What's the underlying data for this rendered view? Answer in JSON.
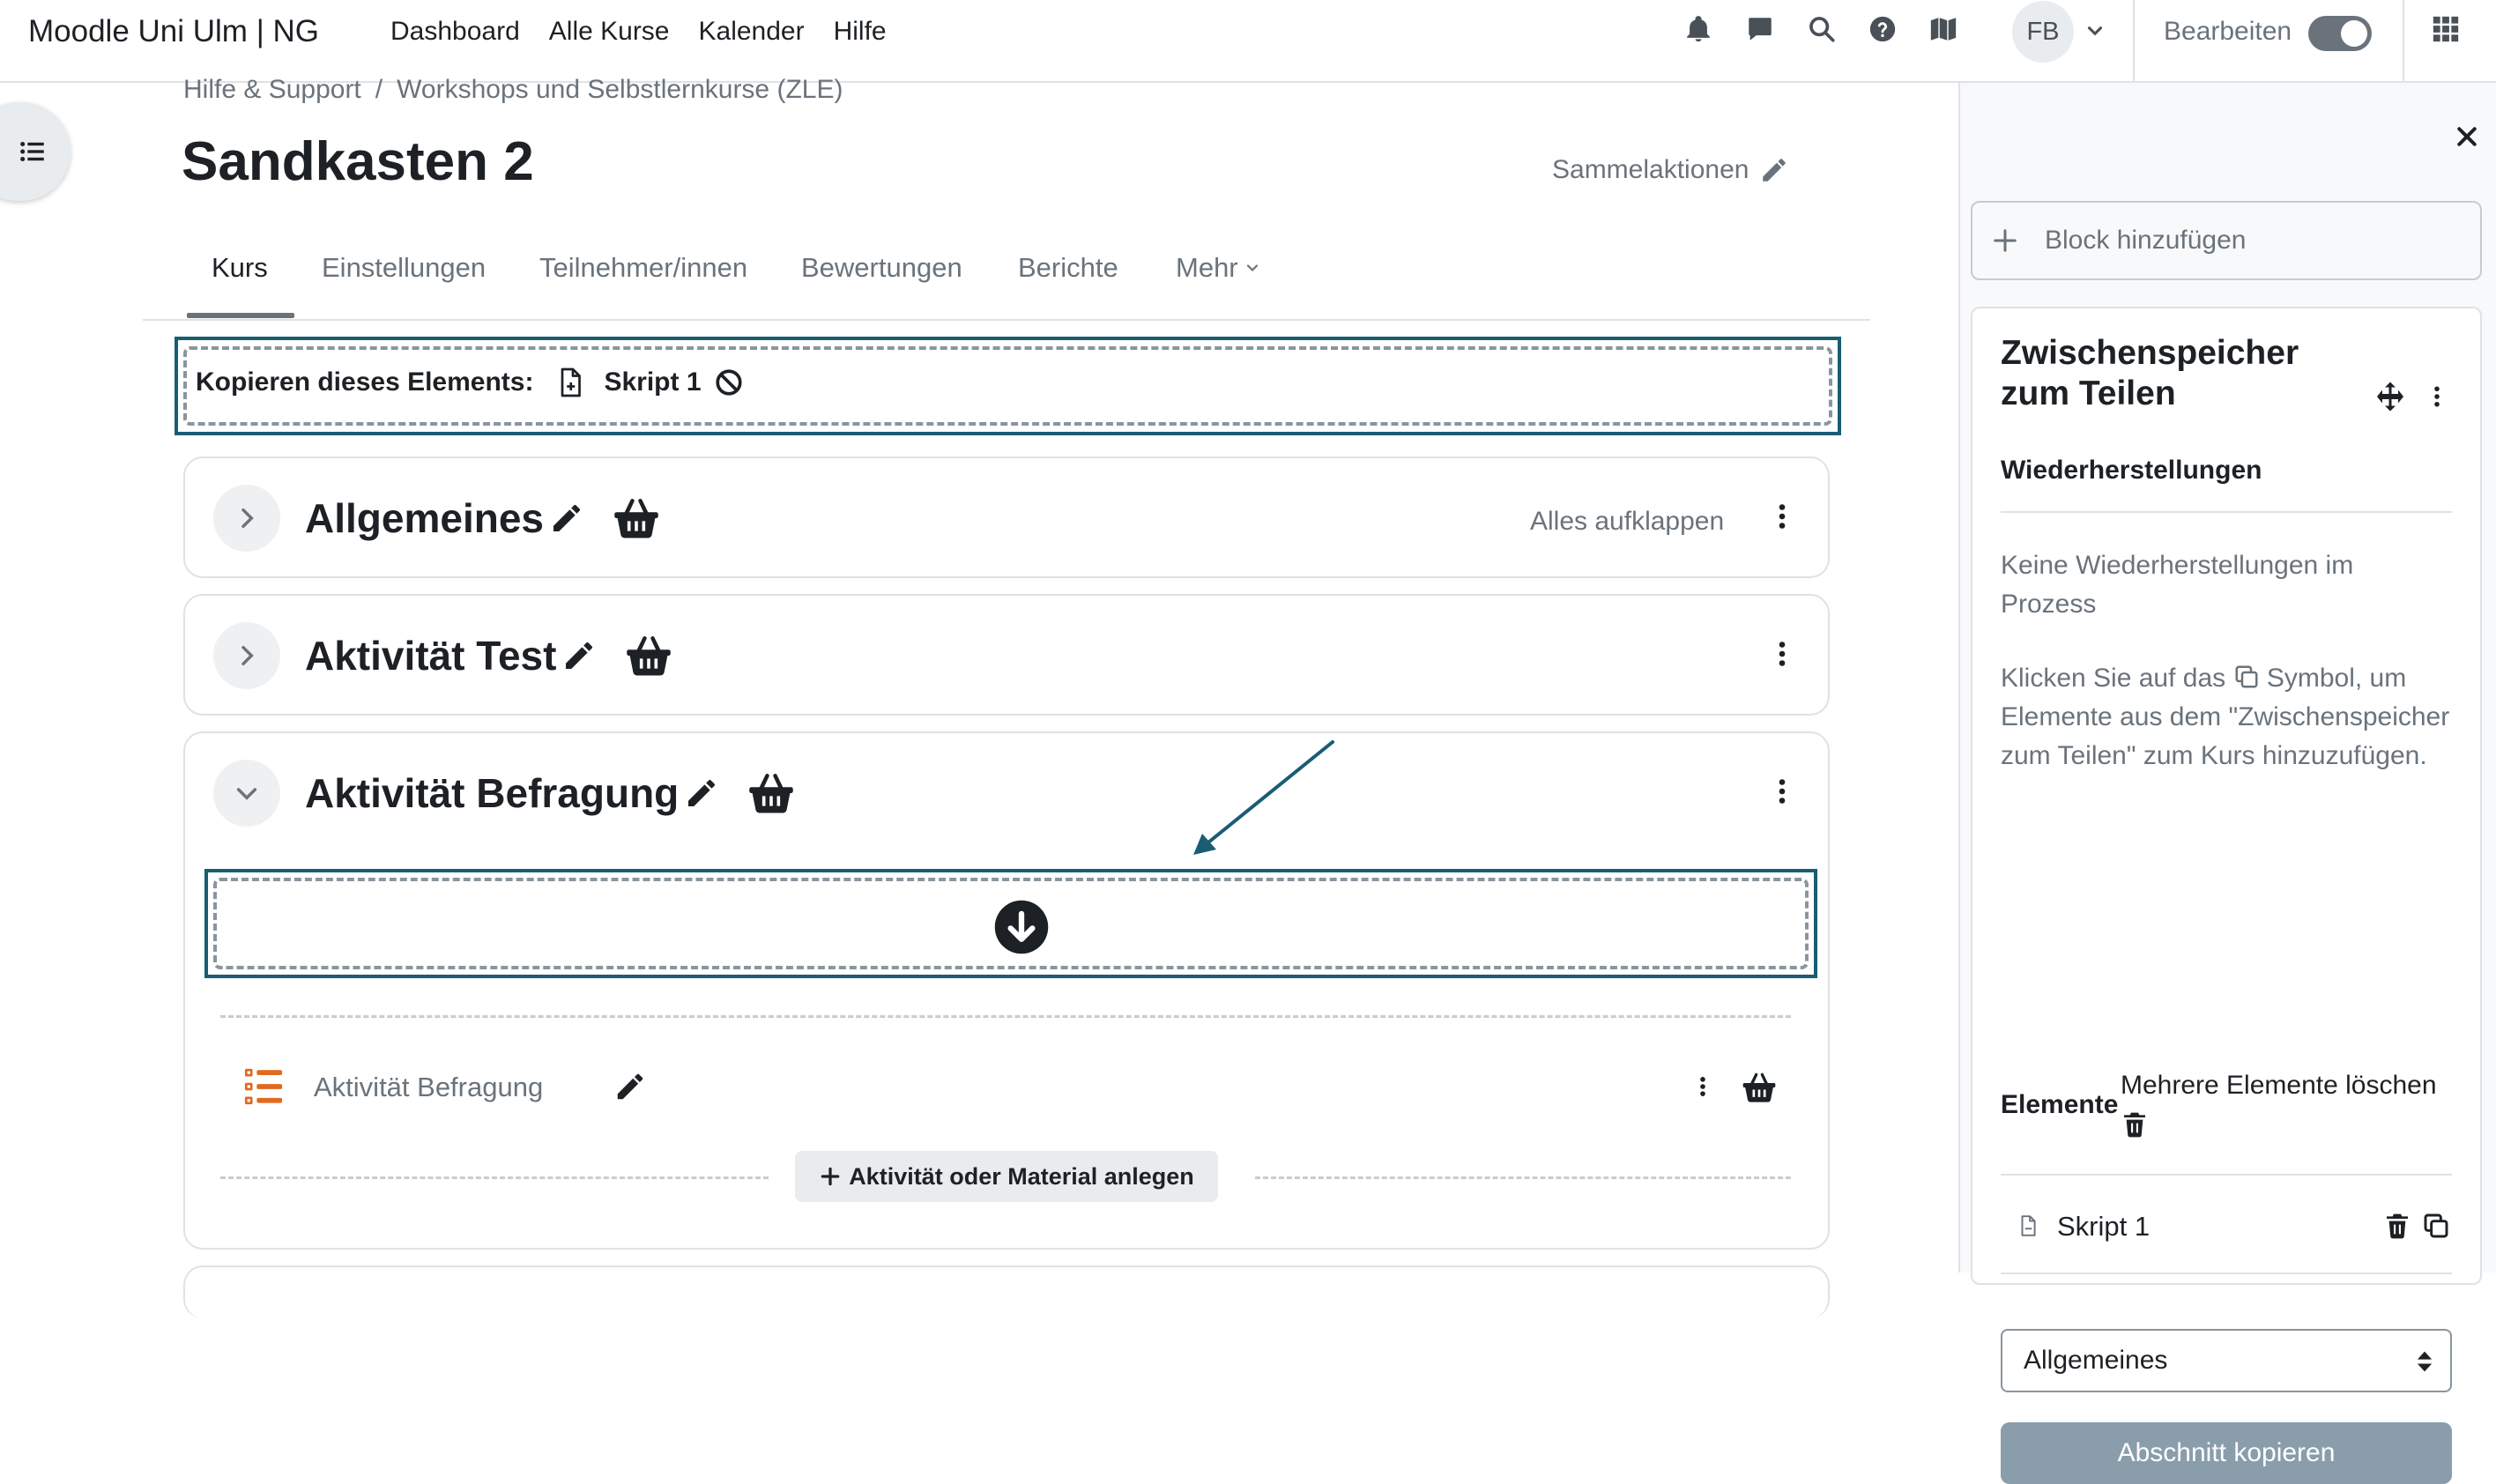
{
  "navbar": {
    "brand": "Moodle Uni Ulm | NG",
    "items": [
      {
        "label": "Dashboard"
      },
      {
        "label": "Alle Kurse"
      },
      {
        "label": "Kalender"
      },
      {
        "label": "Hilfe"
      }
    ],
    "user_initials": "FB",
    "edit_mode_label": "Bearbeiten",
    "edit_mode_on": true
  },
  "breadcrumb": [
    "Hilfe & Support",
    "Workshops und Selbstlernkurse (ZLE)"
  ],
  "breadcrumb_separator": "/",
  "page_title": "Sandkasten 2",
  "bulk_actions_label": "Sammelaktionen",
  "tabs": [
    {
      "label": "Kurs",
      "active": true
    },
    {
      "label": "Einstellungen"
    },
    {
      "label": "Teilnehmer/innen"
    },
    {
      "label": "Bewertungen"
    },
    {
      "label": "Berichte"
    },
    {
      "label": "Mehr"
    }
  ],
  "copy_bar": {
    "label": "Kopieren dieses Elements:",
    "item_name": "Skript 1"
  },
  "sections": [
    {
      "title": "Allgemeines",
      "collapsed": true,
      "expand_all_label": "Alles aufklappen"
    },
    {
      "title": "Aktivität Test",
      "collapsed": true
    },
    {
      "title": "Aktivität Befragung",
      "collapsed": false,
      "activity": {
        "name": "Aktivität Befragung"
      },
      "add_activity_label": "Aktivität oder Material anlegen"
    }
  ],
  "drawer": {
    "add_block_label": "Block hinzufügen",
    "block_title": "Zwischenspeicher zum Teilen",
    "restores_heading": "Wiederherstellungen",
    "no_restores_text": "Keine Wiederherstellungen im Prozess",
    "instructions_before": "Klicken Sie auf das",
    "instructions_after": "Symbol, um Elemente aus dem \"Zwischenspeicher zum Teilen\" zum Kurs hinzuzufügen.",
    "elements_label": "Elemente",
    "delete_multiple_label": "Mehrere Elemente löschen",
    "items": [
      {
        "name": "Skript 1"
      }
    ],
    "section_select_value": "Allgemeines",
    "copy_section_label": "Abschnitt kopieren"
  },
  "colors": {
    "accent_border": "#195d73",
    "disabled_button": "#8a9dab",
    "activity_icon": "#e06a1f"
  }
}
